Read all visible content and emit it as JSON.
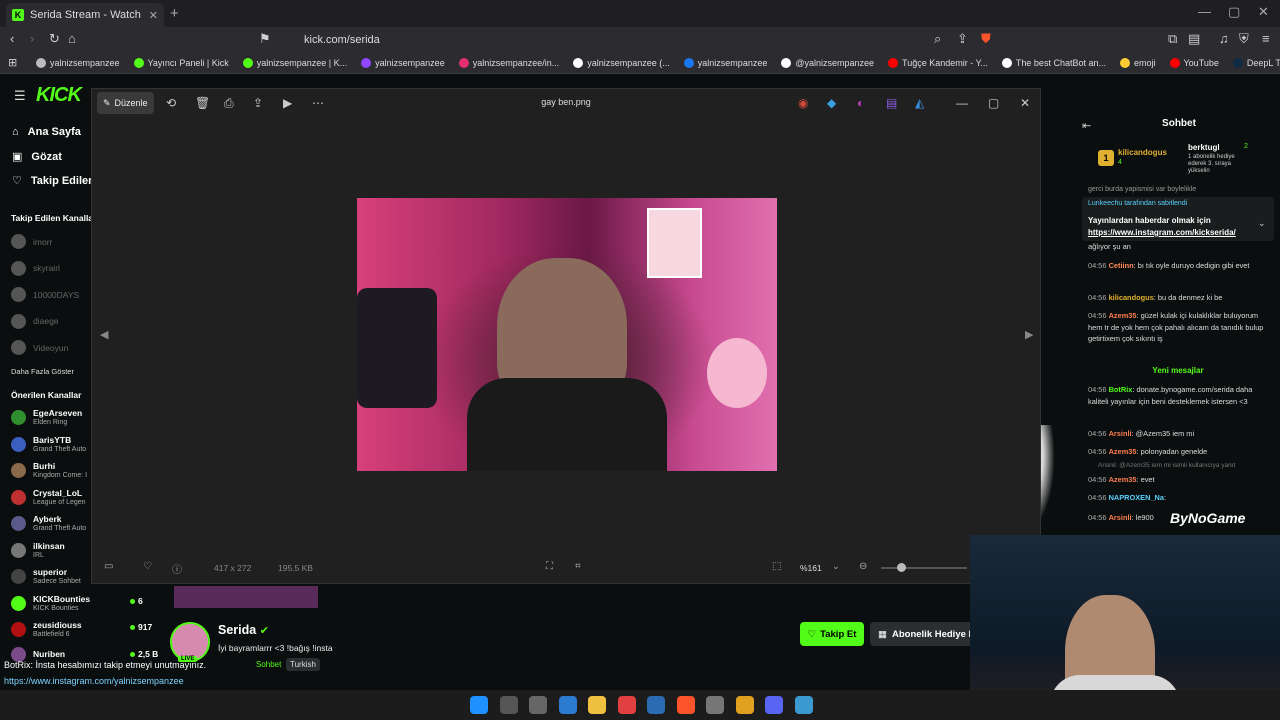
{
  "browser": {
    "tab_title": "Serida Stream - Watch Live o",
    "url": "kick.com/serida",
    "new_tab": "+",
    "bookmarks": [
      {
        "label": "yalnizsempanzee",
        "color": "#bbbbbb"
      },
      {
        "label": "Yayıncı Paneli | Kick",
        "color": "#53fc18"
      },
      {
        "label": "yalnizsempanzee | K...",
        "color": "#53fc18"
      },
      {
        "label": "yalnizsempanzee",
        "color": "#9146ff"
      },
      {
        "label": "yalnizsempanzee/in...",
        "color": "#e1306c"
      },
      {
        "label": "yalnizsempanzee (...",
        "color": "#ffffff"
      },
      {
        "label": "yalnizsempanzee",
        "color": "#1877f2"
      },
      {
        "label": "@yalnizsempanzee",
        "color": "#ffffff"
      },
      {
        "label": "Tuğçe Kandemir - Y...",
        "color": "#ff0000"
      },
      {
        "label": "The best ChatBot an...",
        "color": "#ffffff"
      },
      {
        "label": "emoji",
        "color": "#ffcc33"
      },
      {
        "label": "YouTube",
        "color": "#ff0000"
      },
      {
        "label": "DeepL Translate: Dü...",
        "color": "#0f2b46"
      }
    ]
  },
  "kick": {
    "logo": "KICK",
    "nav": {
      "home": "Ana Sayfa",
      "browse": "Gözat",
      "following": "Takip Edilen I"
    },
    "followed_section": "Takip Edilen Kanalla",
    "followed": [
      "imorr",
      "skyrairl",
      "10000DAYS",
      "diaege",
      "Videoyun"
    ],
    "show_more": "Daha Fazla Göster",
    "recommended_section": "Önerilen Kanallar",
    "recommended": [
      {
        "name": "EgeArseven",
        "game": "Elden Ring",
        "color": "#2f8f2f"
      },
      {
        "name": "BarisYTB",
        "game": "Grand Theft Auto",
        "color": "#3a5fbf"
      },
      {
        "name": "Burhi",
        "game": "Kingdom Come: I",
        "color": "#8a6a4a"
      },
      {
        "name": "Crystal_LoL",
        "game": "League of Legen",
        "color": "#c03030"
      },
      {
        "name": "Ayberk",
        "game": "Grand Theft Auto",
        "color": "#5a5a8a"
      },
      {
        "name": "ilkinsan",
        "game": "IRL",
        "color": "#777777"
      },
      {
        "name": "superior",
        "game": "Sadece Sohbet",
        "color": "#444444"
      },
      {
        "name": "KICKBounties",
        "game": "KICK Bounties",
        "color": "#53fc18",
        "viewers": "6"
      },
      {
        "name": "zeusidiouss",
        "game": "Battlefield 6",
        "color": "#b01010",
        "viewers": "917"
      },
      {
        "name": "Nuriben",
        "game": "",
        "color": "#7a4a8a",
        "viewers": "2,5 B"
      }
    ],
    "streamer": {
      "name": "Serida",
      "title": "İyi bayramlarrr <3 !bağış !insta",
      "category_tag": "Sohbet",
      "language_tag": "Turkish",
      "follow_label": "Takip Et",
      "gift_label": "Abonelik Hediye E"
    },
    "bot_message": "BotRix: İnsta hesabımızı takip etmeyi unutmayınız.",
    "bot_link": "https://www.instagram.com/yalnizsempanzee"
  },
  "viewer": {
    "edit_label": "Düzenle",
    "file_name": "gay ben.png",
    "dimensions": "417 x 272",
    "file_size": "195.5 KB",
    "zoom": "%161"
  },
  "chat": {
    "title": "Sohbet",
    "top_gifter": "kilicandogus",
    "top_gifter_count": "4",
    "gifter2": "berktugl",
    "gifter2_count": "2",
    "gifter2_note": "1 abonelik hediye ederek 3. sıraya yükselin",
    "partial": "gerci burda yapismisi var boylelikle",
    "pinned_by": "Lunkeechu tarafından sabitlendi",
    "pinned_text": "Yayınlardan haberdar olmak için",
    "pinned_link": "https://www.instagram.com/kickserida/",
    "pre": "ağlıyor şu an",
    "new_messages": "Yeni mesajlar",
    "messages": [
      {
        "time": "04:56",
        "user": "Cetiinn",
        "color": "#ff8a5a",
        "text": "bı tık oyle duruyo dedigin gibi evet"
      },
      {
        "time": "04:56",
        "user": "kilicandogus",
        "color": "#e0b030",
        "text": "bu da denmez ki be"
      },
      {
        "time": "04:56",
        "user": "Azem35",
        "color": "#ff7f50",
        "text": "güzel kulak içi kulaklıklar buluyorum hem tr de yok hem çok pahalı alıcam da tanıdık bulup getirtixem çok sıkıntı iş"
      },
      {
        "time": "04:56",
        "user": "BotRix",
        "color": "#53fc18",
        "text": "donate.bynogame.com/serida daha kaliteli yayınlar için beni desteklemek istersen <3"
      },
      {
        "time": "04:56",
        "user": "Arsinli",
        "color": "#ff7f50",
        "text": "@Azem35 iem mi"
      },
      {
        "time": "04:56",
        "user": "Azem35",
        "color": "#ff7f50",
        "text": "polonyadan genelde"
      },
      {
        "time": "04:56",
        "user": "Azem35",
        "color": "#ff7f50",
        "text": "evet"
      },
      {
        "time": "04:56",
        "user": "NAPROXEN_Na",
        "color": "#5ad0ff",
        "text": ""
      },
      {
        "time": "04:56",
        "user": "Arsinli",
        "color": "#ff7f50",
        "text": "le900"
      }
    ],
    "reply_ref": "Arsinli: @Azem35 iem mi isimli kullanıcıya yanıt",
    "sponsor": "ByNoGame"
  },
  "colors": {
    "kick_green": "#53fc18",
    "viewer_bg": "#202020"
  }
}
